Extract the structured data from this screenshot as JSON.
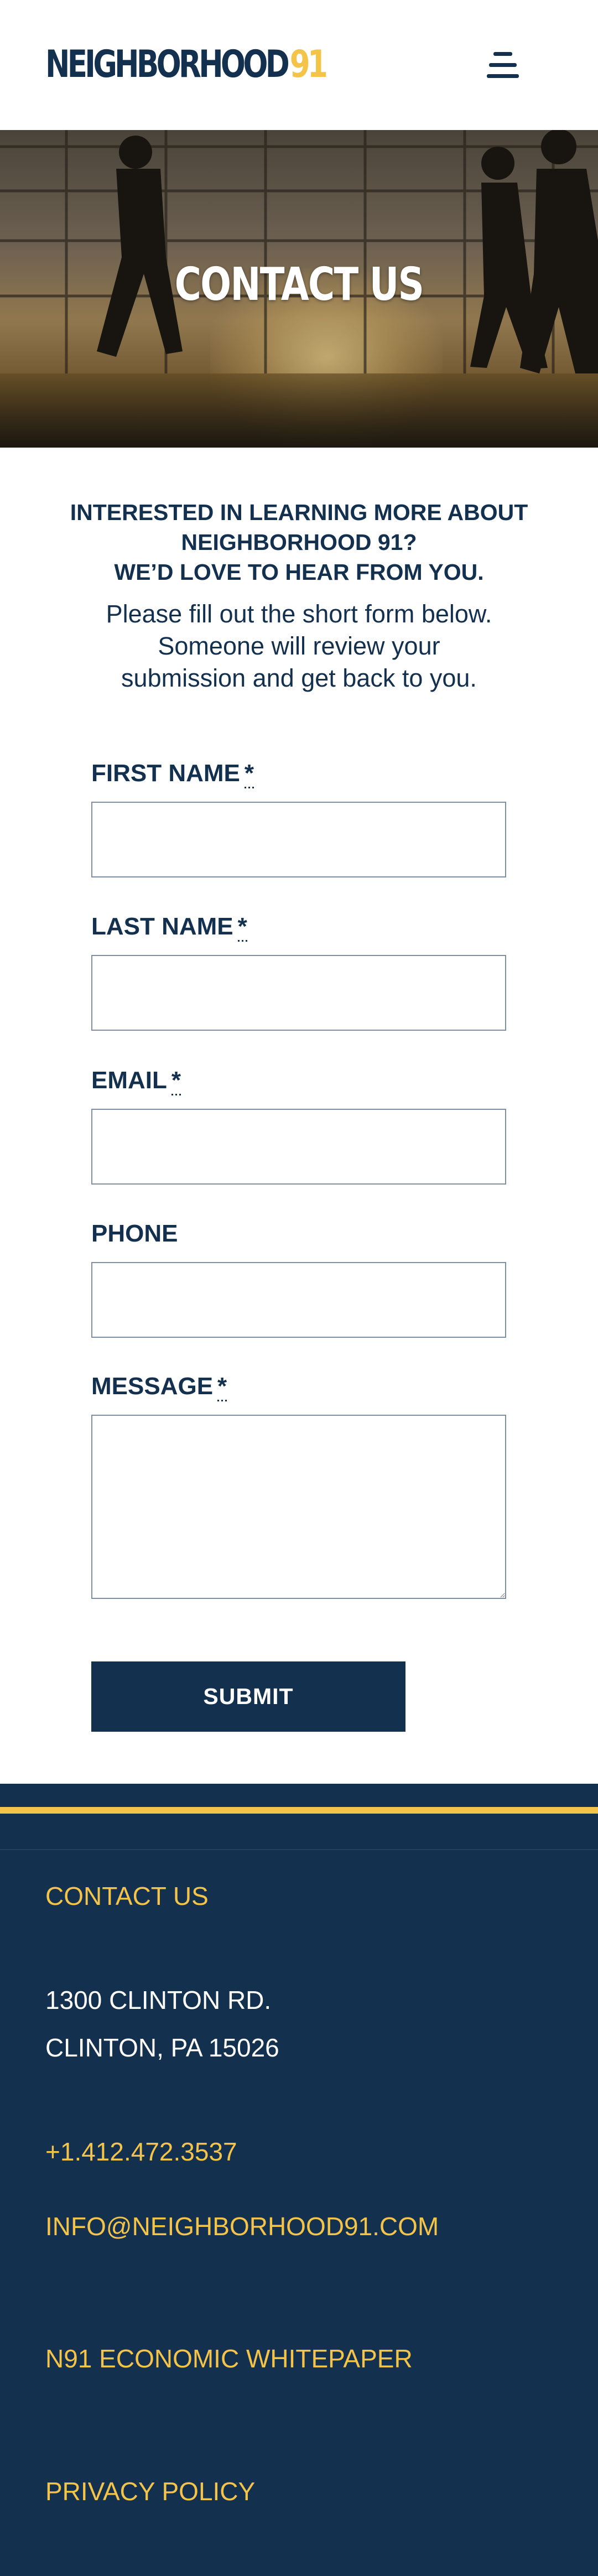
{
  "header": {
    "logo_word": "NEIGHBORHOOD",
    "logo_number": "91"
  },
  "hero": {
    "title": "CONTACT US"
  },
  "intro": {
    "heading_line1": "INTERESTED IN LEARNING MORE ABOUT",
    "heading_line2": "NEIGHBORHOOD 91?",
    "heading_line3": "WE’D LOVE TO HEAR FROM YOU.",
    "body": "Please fill out the short form below. Someone will review your submission and get back to you."
  },
  "form": {
    "required_marker": "*",
    "first_name_label": "FIRST NAME",
    "first_name_value": "",
    "last_name_label": "LAST NAME",
    "last_name_value": "",
    "email_label": "EMAIL",
    "email_value": "",
    "phone_label": "PHONE",
    "phone_value": "",
    "message_label": "MESSAGE",
    "message_value": "",
    "submit_label": "SUBMIT"
  },
  "footer": {
    "contact_heading": "CONTACT US",
    "address_line1": "1300 CLINTON RD.",
    "address_line2": "CLINTON, PA 15026",
    "phone": "+1.412.472.3537",
    "email": "INFO@NEIGHBORHOOD91.COM",
    "whitepaper_link": "N91 ECONOMIC WHITEPAPER",
    "privacy_link": "PRIVACY POLICY"
  },
  "colors": {
    "navy": "#13304f",
    "gold": "#f3c34a",
    "white": "#ffffff",
    "input_border": "#7e8ea3"
  },
  "icons": {
    "menu": "hamburger-menu-icon"
  }
}
